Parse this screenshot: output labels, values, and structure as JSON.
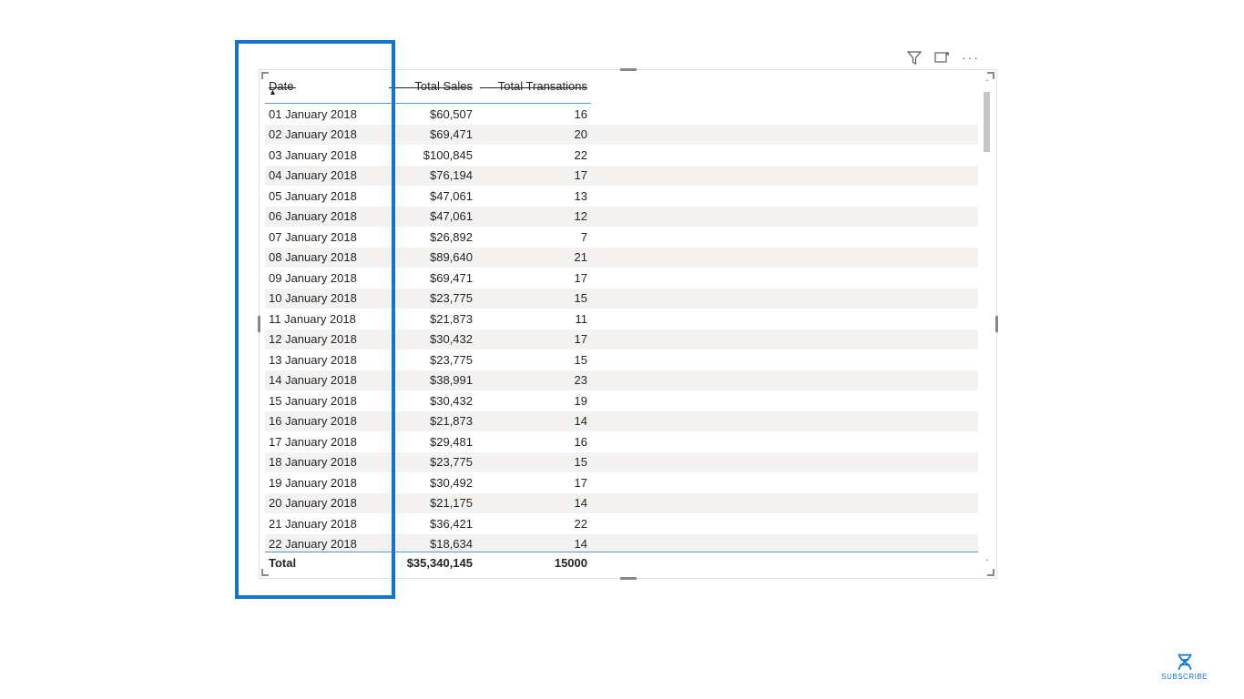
{
  "columns": {
    "date": "Date",
    "sales": "Total Sales",
    "trans": "Total Transations"
  },
  "rows": [
    {
      "date": "01 January 2018",
      "sales": "$60,507",
      "trans": "16"
    },
    {
      "date": "02 January 2018",
      "sales": "$69,471",
      "trans": "20"
    },
    {
      "date": "03 January 2018",
      "sales": "$100,845",
      "trans": "22"
    },
    {
      "date": "04 January 2018",
      "sales": "$76,194",
      "trans": "17"
    },
    {
      "date": "05 January 2018",
      "sales": "$47,061",
      "trans": "13"
    },
    {
      "date": "06 January 2018",
      "sales": "$47,061",
      "trans": "12"
    },
    {
      "date": "07 January 2018",
      "sales": "$26,892",
      "trans": "7"
    },
    {
      "date": "08 January 2018",
      "sales": "$89,640",
      "trans": "21"
    },
    {
      "date": "09 January 2018",
      "sales": "$69,471",
      "trans": "17"
    },
    {
      "date": "10 January 2018",
      "sales": "$23,775",
      "trans": "15"
    },
    {
      "date": "11 January 2018",
      "sales": "$21,873",
      "trans": "11"
    },
    {
      "date": "12 January 2018",
      "sales": "$30,432",
      "trans": "17"
    },
    {
      "date": "13 January 2018",
      "sales": "$23,775",
      "trans": "15"
    },
    {
      "date": "14 January 2018",
      "sales": "$38,991",
      "trans": "23"
    },
    {
      "date": "15 January 2018",
      "sales": "$30,432",
      "trans": "19"
    },
    {
      "date": "16 January 2018",
      "sales": "$21,873",
      "trans": "14"
    },
    {
      "date": "17 January 2018",
      "sales": "$29,481",
      "trans": "16"
    },
    {
      "date": "18 January 2018",
      "sales": "$23,775",
      "trans": "15"
    },
    {
      "date": "19 January 2018",
      "sales": "$30,492",
      "trans": "17"
    },
    {
      "date": "20 January 2018",
      "sales": "$21,175",
      "trans": "14"
    },
    {
      "date": "21 January 2018",
      "sales": "$36,421",
      "trans": "22"
    },
    {
      "date": "22 January 2018",
      "sales": "$18,634",
      "trans": "14"
    }
  ],
  "total": {
    "label": "Total",
    "sales": "$35,340,145",
    "trans": "15000"
  },
  "subscribe_label": "SUBSCRIBE"
}
